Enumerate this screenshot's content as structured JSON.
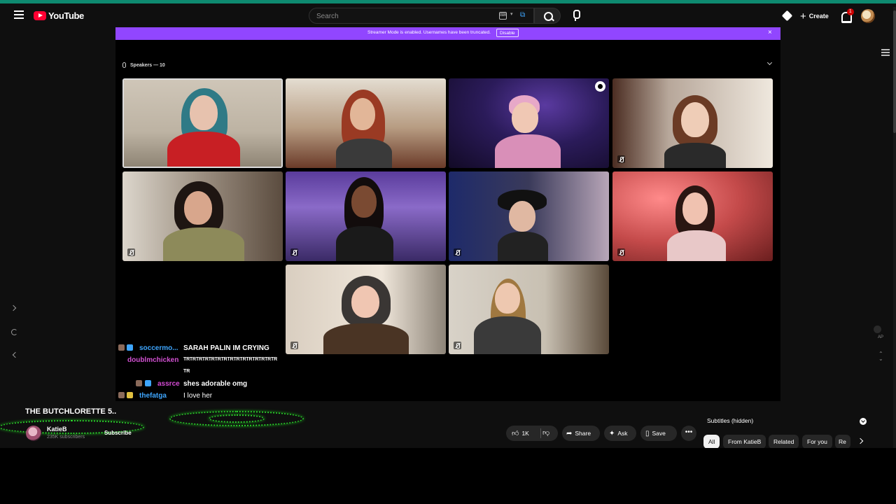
{
  "header": {
    "logo_text": "YouTube",
    "search_placeholder": "Search",
    "create_label": "Create",
    "notification_count": "1"
  },
  "player": {
    "streamer_banner_text": "Streamer Mode is enabled. Usernames have been truncated.",
    "disable_label": "Disable",
    "close_glyph": "×",
    "speakers_label": "Speakers — 10"
  },
  "chat": {
    "lines": [
      {
        "user": "soccermo...",
        "message": "SARAH PALIN IM CRYING",
        "user_color": "#3ea6ff"
      },
      {
        "user": "doublmchicken",
        "message": "TRTRTRTRTRTRTRTRTRTRTRTRTRTRTR",
        "message_overflow": "TR",
        "user_color": "#d050d0"
      },
      {
        "user": "assrce",
        "message": "shes adorable omg",
        "user_color": "#d44bd4"
      },
      {
        "user": "thefatga",
        "message": "I love her",
        "user_color": "#3ea6ff"
      }
    ]
  },
  "video": {
    "title": "THE BUTCHLORETTE 5..",
    "channel": "KatieB",
    "subscribers": "235K subscribers",
    "subscribe_label": "Subscribe"
  },
  "actions": {
    "like_count": "1K",
    "share_label": "Share",
    "ask_label": "Ask",
    "save_label": "Save",
    "more_glyph": "•••"
  },
  "sidebar": {
    "subtitles_label": "Subtitles (hidden)",
    "chips": [
      "All",
      "From KatieB",
      "Related",
      "For you",
      "Re"
    ],
    "rail_label": "AP"
  },
  "icons": {
    "like": "thumbs-up-icon",
    "dislike": "thumbs-down-icon",
    "share": "share-icon",
    "ask": "sparkle-icon",
    "save": "bookmark-icon"
  },
  "colors": {
    "accent_top": "#0e8a70",
    "streamer_banner": "#9146ff",
    "youtube_red": "#ff0033"
  }
}
